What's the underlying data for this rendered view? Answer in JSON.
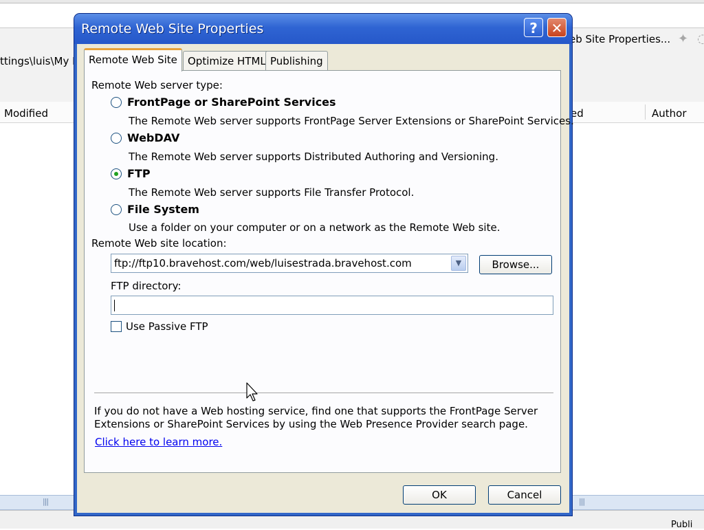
{
  "background": {
    "path_fragment": "ttings\\luis\\My D",
    "toolbar_item": "eb Site Properties...",
    "columns": {
      "modified": "Modified",
      "ed": "ed",
      "author": "Author"
    },
    "status_text": "Publi"
  },
  "dialog": {
    "title": "Remote Web Site Properties",
    "help_button": "?",
    "close_button": "✕",
    "tabs": [
      {
        "label": "Remote Web Site",
        "active": true
      },
      {
        "label": "Optimize HTML",
        "active": false
      },
      {
        "label": "Publishing",
        "active": false
      }
    ],
    "server_type_label": "Remote Web server type:",
    "options": [
      {
        "label": "FrontPage or SharePoint Services",
        "description": "The Remote Web server supports FrontPage Server Extensions or SharePoint Services.",
        "checked": false
      },
      {
        "label": "WebDAV",
        "description": "The Remote Web server supports Distributed Authoring and Versioning.",
        "checked": false
      },
      {
        "label": "FTP",
        "description": "The Remote Web server supports File Transfer Protocol.",
        "checked": true
      },
      {
        "label": "File System",
        "description": "Use a folder on your computer or on a network as the Remote Web site.",
        "checked": false
      }
    ],
    "location_label": "Remote Web site location:",
    "location_value": "ftp://ftp10.bravehost.com/web/luisestrada.bravehost.com",
    "browse_button": "Browse...",
    "ftp_directory_label": "FTP directory:",
    "ftp_directory_value": "",
    "passive_ftp_label": "Use Passive FTP",
    "passive_ftp_checked": false,
    "footer_text": "If you do not have a Web hosting service, find one that supports the FrontPage Server Extensions or SharePoint Services by using the Web Presence Provider search page.",
    "learn_more_link": "Click here to learn more.",
    "ok_button": "OK",
    "cancel_button": "Cancel"
  }
}
